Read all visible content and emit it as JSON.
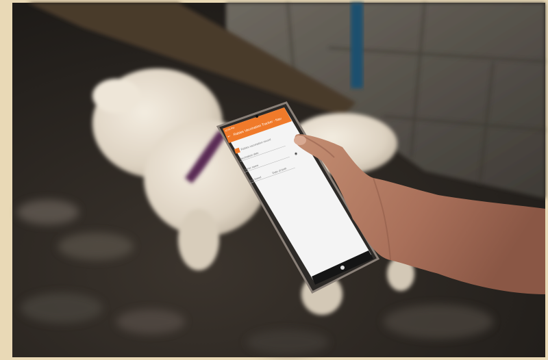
{
  "scene": {
    "subject": "hand holding smartphone",
    "background": "fluffy white dog on dirt floor",
    "border_color": "#e9d9b6"
  },
  "app": {
    "accent_color": "#f07a2a",
    "status_time": "12:55 PM",
    "title": "Rabies Vaccination Tracker - Nav",
    "record_title": "Rabies vaccination record",
    "field_1_label": "Vaccination date",
    "field_2_label": "Owner name",
    "field_3_left": "Dog breed",
    "field_3_right": "Date of birth",
    "app_icon": "syringe-icon",
    "back_icon": "back-arrow-icon"
  }
}
